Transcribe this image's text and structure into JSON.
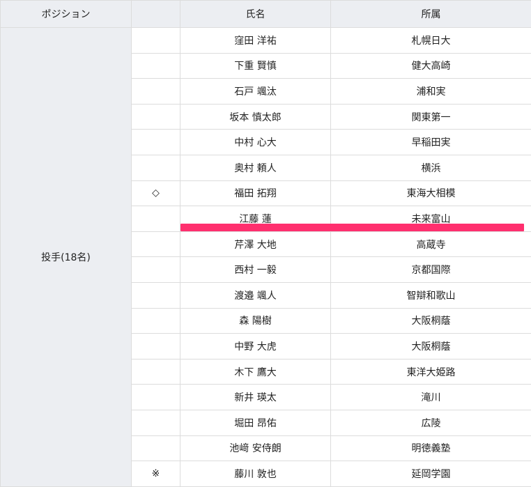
{
  "header": {
    "position": "ポジション",
    "mark": "",
    "name": "氏名",
    "team": "所属"
  },
  "position_group": "投手(18名)",
  "players": [
    {
      "mark": "",
      "name": "窪田 洋祐",
      "team": "札幌日大"
    },
    {
      "mark": "",
      "name": "下重 賢慎",
      "team": "健大高崎"
    },
    {
      "mark": "",
      "name": "石戸 颯汰",
      "team": "浦和実"
    },
    {
      "mark": "",
      "name": "坂本 慎太郎",
      "team": "関東第一"
    },
    {
      "mark": "",
      "name": "中村 心大",
      "team": "早稲田実"
    },
    {
      "mark": "",
      "name": "奥村 頼人",
      "team": "横浜"
    },
    {
      "mark": "◇",
      "name": "福田 拓翔",
      "team": "東海大相模"
    },
    {
      "mark": "",
      "name": "江藤 蓮",
      "team": "未来富山"
    },
    {
      "mark": "",
      "name": "芹澤 大地",
      "team": "高蔵寺"
    },
    {
      "mark": "",
      "name": "西村 一毅",
      "team": "京都国際"
    },
    {
      "mark": "",
      "name": "渡邉 颯人",
      "team": "智辯和歌山"
    },
    {
      "mark": "",
      "name": "森 陽樹",
      "team": "大阪桐蔭"
    },
    {
      "mark": "",
      "name": "中野 大虎",
      "team": "大阪桐蔭"
    },
    {
      "mark": "",
      "name": "木下 鷹大",
      "team": "東洋大姫路"
    },
    {
      "mark": "",
      "name": "新井 瑛太",
      "team": "滝川"
    },
    {
      "mark": "",
      "name": "堀田 昂佑",
      "team": "広陵"
    },
    {
      "mark": "",
      "name": "池﨑 安侍朗",
      "team": "明徳義塾"
    },
    {
      "mark": "※",
      "name": "藤川 敦也",
      "team": "延岡学園"
    }
  ],
  "highlight_color": "#ff2f6e"
}
